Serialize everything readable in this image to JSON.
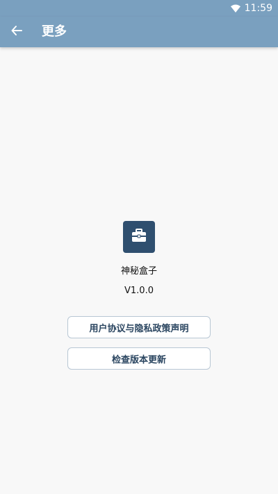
{
  "status_bar": {
    "time": "11:59",
    "wifi_icon": "wifi-icon"
  },
  "app_bar": {
    "back_icon": "arrow-left-icon",
    "title": "更多"
  },
  "about": {
    "app_icon": "toolbox-icon",
    "app_name": "神秘盒子",
    "version": "V1.0.0"
  },
  "actions": {
    "privacy_button": "用户协议与隐私政策声明",
    "update_button": "检查版本更新"
  },
  "colors": {
    "header_bg": "#7aa0bf",
    "icon_bg": "#2f4f6f",
    "button_text": "#2a4560",
    "page_bg": "#f8f8f8"
  }
}
